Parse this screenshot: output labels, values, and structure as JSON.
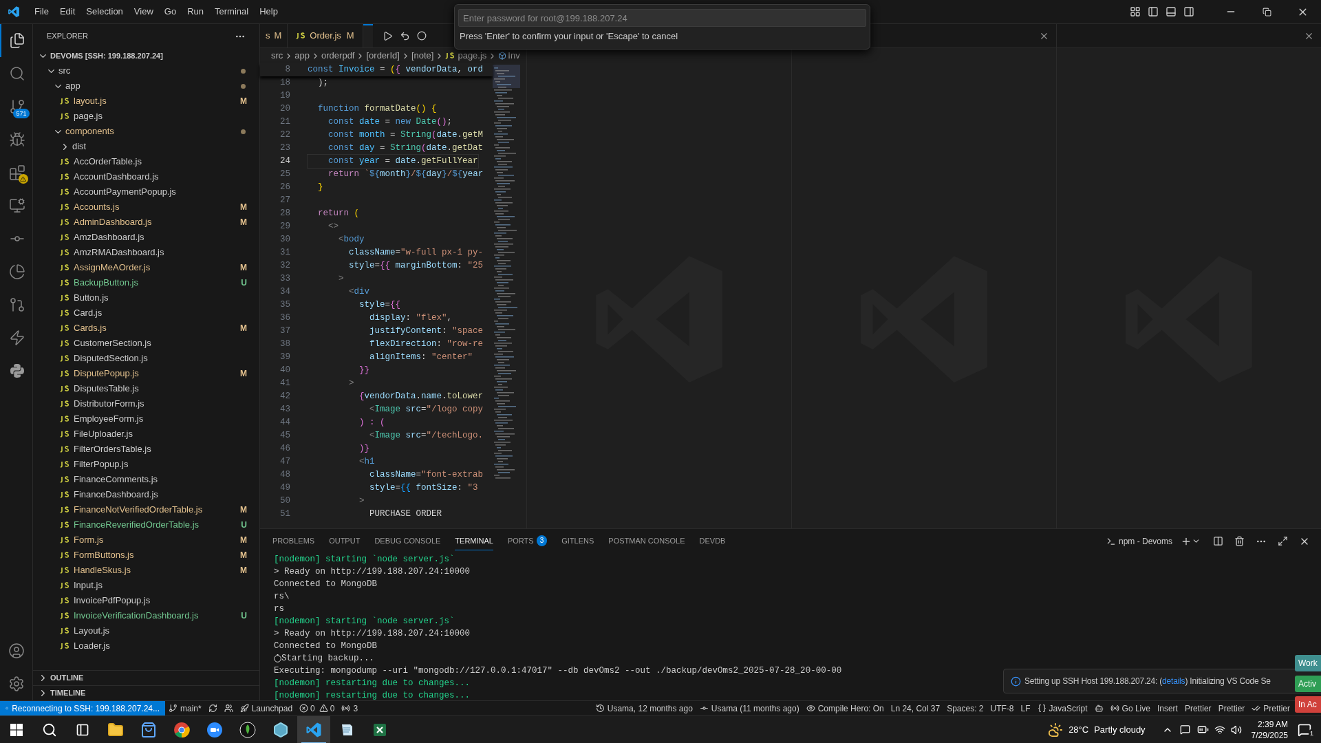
{
  "title_bar": {
    "menus": [
      "File",
      "Edit",
      "Selection",
      "View",
      "Go",
      "Run",
      "Terminal",
      "Help"
    ]
  },
  "command_palette": {
    "placeholder": "Enter password for root@199.188.207.24",
    "hint": "Press 'Enter' to confirm your input or 'Escape' to cancel"
  },
  "activity_bar": {
    "items": [
      {
        "selected": true,
        "alert": false
      },
      {
        "selected": false,
        "alert": false
      },
      {
        "selected": false,
        "alert": false,
        "badge": "571"
      },
      {
        "selected": false,
        "alert": false
      },
      {
        "selected": false,
        "alert": true
      },
      {
        "selected": false,
        "alert": false
      },
      {
        "selected": false,
        "alert": false
      },
      {
        "selected": false,
        "alert": false
      },
      {
        "selected": false,
        "alert": false
      },
      {
        "selected": false,
        "alert": false
      },
      {
        "selected": false,
        "alert": false
      }
    ]
  },
  "explorer": {
    "title": "EXPLORER",
    "root": {
      "label": "DEVOMS [SSH: 199.188.207.24]",
      "expanded": true,
      "children": [
        {
          "kind": "folder",
          "label": "src",
          "expanded": true,
          "modified": true,
          "color": "#cccccc",
          "children": [
            {
              "kind": "folder",
              "label": "app",
              "expanded": true,
              "modified": true,
              "color": "#cccccc",
              "children": [
                {
                  "kind": "file",
                  "label": "layout.js",
                  "color": "#e2c08d",
                  "badge": "M"
                },
                {
                  "kind": "file",
                  "label": "page.js",
                  "color": "#cccccc"
                }
              ]
            },
            {
              "kind": "folder",
              "label": "components",
              "expanded": true,
              "modified": true,
              "color": "#e2c08d",
              "children": [
                {
                  "kind": "folder",
                  "label": "dist",
                  "expanded": false,
                  "modified": false,
                  "color": "#cccccc"
                },
                {
                  "kind": "file",
                  "label": "AccOrderTable.js",
                  "color": "#cccccc"
                },
                {
                  "kind": "file",
                  "label": "AccountDashboard.js",
                  "color": "#cccccc"
                },
                {
                  "kind": "file",
                  "label": "AccountPaymentPopup.js",
                  "color": "#cccccc"
                },
                {
                  "kind": "file",
                  "label": "Accounts.js",
                  "color": "#e2c08d",
                  "badge": "M"
                },
                {
                  "kind": "file",
                  "label": "AdminDashboard.js",
                  "color": "#e2c08d",
                  "badge": "M"
                },
                {
                  "kind": "file",
                  "label": "AmzDashboard.js",
                  "color": "#cccccc"
                },
                {
                  "kind": "file",
                  "label": "AmzRMADashboard.js",
                  "color": "#cccccc"
                },
                {
                  "kind": "file",
                  "label": "AssignMeAOrder.js",
                  "color": "#e2c08d",
                  "badge": "M"
                },
                {
                  "kind": "file",
                  "label": "BackupButton.js",
                  "color": "#73c991",
                  "badge": "U"
                },
                {
                  "kind": "file",
                  "label": "Button.js",
                  "color": "#cccccc"
                },
                {
                  "kind": "file",
                  "label": "Card.js",
                  "color": "#cccccc"
                },
                {
                  "kind": "file",
                  "label": "Cards.js",
                  "color": "#e2c08d",
                  "badge": "M"
                },
                {
                  "kind": "file",
                  "label": "CustomerSection.js",
                  "color": "#cccccc"
                },
                {
                  "kind": "file",
                  "label": "DisputedSection.js",
                  "color": "#cccccc"
                },
                {
                  "kind": "file",
                  "label": "DisputePopup.js",
                  "color": "#e2c08d",
                  "badge": "M"
                },
                {
                  "kind": "file",
                  "label": "DisputesTable.js",
                  "color": "#cccccc"
                },
                {
                  "kind": "file",
                  "label": "DistributorForm.js",
                  "color": "#cccccc"
                },
                {
                  "kind": "file",
                  "label": "EmployeeForm.js",
                  "color": "#cccccc"
                },
                {
                  "kind": "file",
                  "label": "FileUploader.js",
                  "color": "#cccccc"
                },
                {
                  "kind": "file",
                  "label": "FilterOrdersTable.js",
                  "color": "#cccccc"
                },
                {
                  "kind": "file",
                  "label": "FilterPopup.js",
                  "color": "#cccccc"
                },
                {
                  "kind": "file",
                  "label": "FinanceComments.js",
                  "color": "#cccccc"
                },
                {
                  "kind": "file",
                  "label": "FinanceDashboard.js",
                  "color": "#cccccc"
                },
                {
                  "kind": "file",
                  "label": "FinanceNotVerifiedOrderTable.js",
                  "color": "#e2c08d",
                  "badge": "M"
                },
                {
                  "kind": "file",
                  "label": "FinanceReverifiedOrderTable.js",
                  "color": "#73c991",
                  "badge": "U"
                },
                {
                  "kind": "file",
                  "label": "Form.js",
                  "color": "#e2c08d",
                  "badge": "M"
                },
                {
                  "kind": "file",
                  "label": "FormButtons.js",
                  "color": "#e2c08d",
                  "badge": "M"
                },
                {
                  "kind": "file",
                  "label": "HandleSkus.js",
                  "color": "#e2c08d",
                  "badge": "M"
                },
                {
                  "kind": "file",
                  "label": "Input.js",
                  "color": "#cccccc"
                },
                {
                  "kind": "file",
                  "label": "InvoicePdfPopup.js",
                  "color": "#cccccc"
                },
                {
                  "kind": "file",
                  "label": "InvoiceVerificationDashboard.js",
                  "color": "#73c991",
                  "badge": "U"
                },
                {
                  "kind": "file",
                  "label": "Layout.js",
                  "color": "#cccccc"
                },
                {
                  "kind": "file",
                  "label": "Loader.js",
                  "color": "#cccccc"
                }
              ]
            }
          ]
        }
      ]
    },
    "sections": [
      {
        "label": "OUTLINE",
        "expanded": false
      },
      {
        "label": "TIMELINE",
        "expanded": false
      }
    ]
  },
  "editor": {
    "tabs": [
      {
        "kind": "cut",
        "label": "s",
        "status": "M",
        "selected": false
      },
      {
        "kind": "file",
        "label": "Order.js",
        "status": "M",
        "selected": false
      },
      {
        "kind": "hidden",
        "selected": true
      }
    ],
    "breadcrumb": [
      {
        "kind": "folder",
        "text": "src"
      },
      {
        "kind": "folder",
        "text": "app"
      },
      {
        "kind": "folder",
        "text": "orderpdf"
      },
      {
        "kind": "folder",
        "text": "[orderId]"
      },
      {
        "kind": "folder",
        "text": "[note]"
      },
      {
        "kind": "file",
        "text": "page.js"
      },
      {
        "kind": "symbol",
        "text": "Inv"
      }
    ],
    "sticky": {
      "n": "8",
      "tokens": [
        {
          "text": "const ",
          "kind": "kw"
        },
        {
          "text": "Invoice",
          "kind": "cst"
        },
        {
          "text": " = ",
          "kind": "p"
        },
        {
          "text": "(",
          "kind": "b1"
        },
        {
          "text": "{",
          "kind": "b2"
        },
        {
          "text": " vendorData",
          "kind": "var"
        },
        {
          "text": ", ",
          "kind": "p"
        },
        {
          "text": "ord",
          "kind": "var"
        }
      ]
    },
    "lines": [
      {
        "n": "18",
        "current": false,
        "tokens": [
          {
            "text": "  );",
            "kind": "p"
          }
        ]
      },
      {
        "n": "19",
        "current": false
      },
      {
        "n": "20",
        "current": false,
        "tokens": [
          {
            "text": "  function ",
            "kind": "kw"
          },
          {
            "text": "formatDate",
            "kind": "fn"
          },
          {
            "text": "() {",
            "kind": "b1"
          }
        ]
      },
      {
        "n": "21",
        "current": false,
        "tokens": [
          {
            "text": "    const ",
            "kind": "kw"
          },
          {
            "text": "date",
            "kind": "cst"
          },
          {
            "text": " = ",
            "kind": "p"
          },
          {
            "text": "new ",
            "kind": "kw"
          },
          {
            "text": "Date",
            "kind": "cls"
          },
          {
            "text": "()",
            "kind": "b2"
          },
          {
            "text": ";",
            "kind": "p"
          }
        ]
      },
      {
        "n": "22",
        "current": false,
        "tokens": [
          {
            "text": "    const ",
            "kind": "kw"
          },
          {
            "text": "month",
            "kind": "cst"
          },
          {
            "text": " = ",
            "kind": "p"
          },
          {
            "text": "String",
            "kind": "cls"
          },
          {
            "text": "(",
            "kind": "b2"
          },
          {
            "text": "date",
            "kind": "var"
          },
          {
            "text": ".",
            "kind": "p"
          },
          {
            "text": "getM",
            "kind": "fn"
          }
        ]
      },
      {
        "n": "23",
        "current": false,
        "tokens": [
          {
            "text": "    const ",
            "kind": "kw"
          },
          {
            "text": "day",
            "kind": "cst"
          },
          {
            "text": " = ",
            "kind": "p"
          },
          {
            "text": "String",
            "kind": "cls"
          },
          {
            "text": "(",
            "kind": "b2"
          },
          {
            "text": "date",
            "kind": "var"
          },
          {
            "text": ".",
            "kind": "p"
          },
          {
            "text": "getDat",
            "kind": "fn"
          }
        ]
      },
      {
        "n": "24",
        "current": true,
        "tokens": [
          {
            "text": "    const ",
            "kind": "kw"
          },
          {
            "text": "year",
            "kind": "cst"
          },
          {
            "text": " = ",
            "kind": "p"
          },
          {
            "text": "date",
            "kind": "var"
          },
          {
            "text": ".",
            "kind": "p"
          },
          {
            "text": "getFullYear",
            "kind": "fn"
          }
        ]
      },
      {
        "n": "25",
        "current": false,
        "tokens": [
          {
            "text": "    return ",
            "kind": "ctl"
          },
          {
            "text": "`",
            "kind": "str"
          },
          {
            "text": "${",
            "kind": "kw"
          },
          {
            "text": "month",
            "kind": "var"
          },
          {
            "text": "}",
            "kind": "kw"
          },
          {
            "text": "/",
            "kind": "str"
          },
          {
            "text": "${",
            "kind": "kw"
          },
          {
            "text": "day",
            "kind": "var"
          },
          {
            "text": "}",
            "kind": "kw"
          },
          {
            "text": "/",
            "kind": "str"
          },
          {
            "text": "${",
            "kind": "kw"
          },
          {
            "text": "year",
            "kind": "var"
          }
        ]
      },
      {
        "n": "26",
        "current": false,
        "tokens": [
          {
            "text": "  }",
            "kind": "b1"
          }
        ]
      },
      {
        "n": "27",
        "current": false
      },
      {
        "n": "28",
        "current": false,
        "tokens": [
          {
            "text": "  return ",
            "kind": "ctl"
          },
          {
            "text": "(",
            "kind": "b1"
          }
        ]
      },
      {
        "n": "29",
        "current": false,
        "tokens": [
          {
            "text": "    <>",
            "kind": "tag"
          }
        ]
      },
      {
        "n": "30",
        "current": false,
        "tokens": [
          {
            "text": "      <",
            "kind": "tag"
          },
          {
            "text": "body",
            "kind": "tn"
          }
        ]
      },
      {
        "n": "31",
        "current": false,
        "tokens": [
          {
            "text": "        className",
            "kind": "attr"
          },
          {
            "text": "=",
            "kind": "p"
          },
          {
            "text": "\"w-full px-1 py-",
            "kind": "str"
          }
        ]
      },
      {
        "n": "32",
        "current": false,
        "tokens": [
          {
            "text": "        style",
            "kind": "attr"
          },
          {
            "text": "=",
            "kind": "p"
          },
          {
            "text": "{{",
            "kind": "b2"
          },
          {
            "text": " marginBottom",
            "kind": "var"
          },
          {
            "text": ": ",
            "kind": "p"
          },
          {
            "text": "\"25",
            "kind": "str"
          }
        ]
      },
      {
        "n": "33",
        "current": false,
        "tokens": [
          {
            "text": "      >",
            "kind": "tag"
          }
        ]
      },
      {
        "n": "34",
        "current": false,
        "tokens": [
          {
            "text": "        <",
            "kind": "tag"
          },
          {
            "text": "div",
            "kind": "tn"
          }
        ]
      },
      {
        "n": "35",
        "current": false,
        "tokens": [
          {
            "text": "          style",
            "kind": "attr"
          },
          {
            "text": "=",
            "kind": "p"
          },
          {
            "text": "{{",
            "kind": "b2"
          }
        ]
      },
      {
        "n": "36",
        "current": false,
        "tokens": [
          {
            "text": "            display",
            "kind": "var"
          },
          {
            "text": ": ",
            "kind": "p"
          },
          {
            "text": "\"flex\"",
            "kind": "str"
          },
          {
            "text": ",",
            "kind": "p"
          }
        ]
      },
      {
        "n": "37",
        "current": false,
        "tokens": [
          {
            "text": "            justifyContent",
            "kind": "var"
          },
          {
            "text": ": ",
            "kind": "p"
          },
          {
            "text": "\"space",
            "kind": "str"
          }
        ]
      },
      {
        "n": "38",
        "current": false,
        "tokens": [
          {
            "text": "            flexDirection",
            "kind": "var"
          },
          {
            "text": ": ",
            "kind": "p"
          },
          {
            "text": "\"row-re",
            "kind": "str"
          }
        ]
      },
      {
        "n": "39",
        "current": false,
        "tokens": [
          {
            "text": "            alignItems",
            "kind": "var"
          },
          {
            "text": ": ",
            "kind": "p"
          },
          {
            "text": "\"center\"",
            "kind": "str"
          }
        ]
      },
      {
        "n": "40",
        "current": false,
        "tokens": [
          {
            "text": "          }}",
            "kind": "b2"
          }
        ]
      },
      {
        "n": "41",
        "current": false,
        "tokens": [
          {
            "text": "        >",
            "kind": "tag"
          }
        ]
      },
      {
        "n": "42",
        "current": false,
        "tokens": [
          {
            "text": "          {",
            "kind": "b2"
          },
          {
            "text": "vendorData",
            "kind": "var"
          },
          {
            "text": ".",
            "kind": "p"
          },
          {
            "text": "name",
            "kind": "var"
          },
          {
            "text": ".",
            "kind": "p"
          },
          {
            "text": "toLower",
            "kind": "fn"
          }
        ]
      },
      {
        "n": "43",
        "current": false,
        "tokens": [
          {
            "text": "            <",
            "kind": "tag"
          },
          {
            "text": "Image",
            "kind": "cls"
          },
          {
            "text": " src",
            "kind": "attr"
          },
          {
            "text": "=",
            "kind": "p"
          },
          {
            "text": "\"/logo copy",
            "kind": "str"
          }
        ]
      },
      {
        "n": "44",
        "current": false,
        "tokens": [
          {
            "text": "          ) : (",
            "kind": "b2"
          }
        ]
      },
      {
        "n": "45",
        "current": false,
        "tokens": [
          {
            "text": "            <",
            "kind": "tag"
          },
          {
            "text": "Image",
            "kind": "cls"
          },
          {
            "text": " src",
            "kind": "attr"
          },
          {
            "text": "=",
            "kind": "p"
          },
          {
            "text": "\"/techLogo.",
            "kind": "str"
          }
        ]
      },
      {
        "n": "46",
        "current": false,
        "tokens": [
          {
            "text": "          )}",
            "kind": "b2"
          }
        ]
      },
      {
        "n": "47",
        "current": false,
        "tokens": [
          {
            "text": "          <",
            "kind": "tag"
          },
          {
            "text": "h1",
            "kind": "tn"
          }
        ]
      },
      {
        "n": "48",
        "current": false,
        "tokens": [
          {
            "text": "            className",
            "kind": "attr"
          },
          {
            "text": "=",
            "kind": "p"
          },
          {
            "text": "\"font-extrab",
            "kind": "str"
          }
        ]
      },
      {
        "n": "49",
        "current": false,
        "tokens": [
          {
            "text": "            style",
            "kind": "attr"
          },
          {
            "text": "=",
            "kind": "p"
          },
          {
            "text": "{{",
            "kind": "b3"
          },
          {
            "text": " fontSize",
            "kind": "var"
          },
          {
            "text": ": ",
            "kind": "p"
          },
          {
            "text": "\"3",
            "kind": "str"
          }
        ]
      },
      {
        "n": "50",
        "current": false,
        "tokens": [
          {
            "text": "          >",
            "kind": "tag"
          }
        ]
      },
      {
        "n": "51",
        "current": false,
        "tokens": [
          {
            "text": "            PURCHASE ORDER",
            "kind": "p"
          }
        ]
      }
    ]
  },
  "panel": {
    "tabs": [
      {
        "label": "PROBLEMS",
        "selected": false
      },
      {
        "label": "OUTPUT",
        "selected": false
      },
      {
        "label": "DEBUG CONSOLE",
        "selected": false
      },
      {
        "label": "TERMINAL",
        "selected": true
      },
      {
        "label": "PORTS",
        "selected": false,
        "badge": "3"
      },
      {
        "label": "GITLENS",
        "selected": false
      },
      {
        "label": "POSTMAN CONSOLE",
        "selected": false
      },
      {
        "label": "DEVDB",
        "selected": false
      }
    ],
    "terminal_name": "npm - Devoms",
    "lines": [
      {
        "kind": "text",
        "text": "[nodemon] starting `node server.js`",
        "color": "#23d18b"
      },
      {
        "kind": "text",
        "text": "> Ready on http://199.188.207.24:10000",
        "color": "#cccccc"
      },
      {
        "kind": "text",
        "text": "Connected to MongoDB",
        "color": "#cccccc"
      },
      {
        "kind": "text",
        "text": "rs\\",
        "color": "#cccccc"
      },
      {
        "kind": "text",
        "text": "rs",
        "color": "#cccccc"
      },
      {
        "kind": "text",
        "text": "[nodemon] starting `node server.js`",
        "color": "#23d18b"
      },
      {
        "kind": "text",
        "text": "> Ready on http://199.188.207.24:10000",
        "color": "#cccccc"
      },
      {
        "kind": "text",
        "text": "Connected to MongoDB",
        "color": "#cccccc"
      },
      {
        "kind": "icon-text",
        "text": "Starting backup...",
        "color": "#cccccc"
      },
      {
        "kind": "text",
        "text": "Executing: mongodump --uri \"mongodb://127.0.0.1:47017\" --db devOms2 --out ./backup/devOms2_2025-07-28_20-00-00",
        "color": "#cccccc"
      },
      {
        "kind": "text",
        "text": "[nodemon] restarting due to changes...",
        "color": "#23d18b"
      },
      {
        "kind": "text",
        "text": "[nodemon] restarting due to changes...",
        "color": "#23d18b"
      }
    ]
  },
  "notification": {
    "before": "Setting up SSH Host 199.188.207.24: (",
    "link": "details",
    "after": ") Initializing VS Code Se"
  },
  "side_buttons": [
    {
      "label": "Work",
      "color": "#3f8f8f"
    },
    {
      "label": "Activ",
      "color": "#2f9e55"
    },
    {
      "label": "In Ac",
      "color": "#d0413b"
    }
  ],
  "status_bar": {
    "left": [
      {
        "kind": "remote",
        "text": "Reconnecting to SSH: 199.188.207.24..."
      },
      {
        "kind": "branch",
        "text": "main*"
      },
      {
        "kind": "sync"
      },
      {
        "kind": "share"
      },
      {
        "kind": "launchpad",
        "text": "Launchpad"
      },
      {
        "kind": "problems",
        "errors": "0",
        "warnings": "0"
      },
      {
        "kind": "ports",
        "text": "3"
      }
    ],
    "right": [
      {
        "kind": "blame",
        "text": "Usama, 12 months ago"
      },
      {
        "kind": "commit",
        "text": "Usama (11 months ago)"
      },
      {
        "kind": "eye",
        "text": "Compile Hero: On"
      },
      {
        "kind": "plain",
        "text": "Ln 24, Col 37"
      },
      {
        "kind": "plain",
        "text": "Spaces: 2"
      },
      {
        "kind": "plain",
        "text": "UTF-8"
      },
      {
        "kind": "plain",
        "text": "LF"
      },
      {
        "kind": "braces",
        "text": "JavaScript"
      },
      {
        "kind": "copilot"
      },
      {
        "kind": "live",
        "text": "Go Live"
      },
      {
        "kind": "plain",
        "text": "Insert"
      },
      {
        "kind": "plain",
        "text": "Prettier"
      },
      {
        "kind": "plain",
        "text": "Prettier"
      },
      {
        "kind": "check",
        "text": "Prettier"
      }
    ]
  },
  "taskbar": {
    "apps": [
      {
        "kind": "explorer",
        "active": false
      },
      {
        "kind": "store",
        "active": false
      },
      {
        "kind": "chrome",
        "active": false
      },
      {
        "kind": "zoom",
        "active": false
      },
      {
        "kind": "leaf",
        "active": false
      },
      {
        "kind": "hex",
        "active": false
      },
      {
        "kind": "vscode",
        "active": true
      },
      {
        "kind": "notes",
        "active": false
      },
      {
        "kind": "sheet",
        "active": false
      }
    ],
    "temperature": "28°C",
    "weather": "Partly cloudy",
    "time": "2:39 AM",
    "date": "7/29/2025",
    "notifications": "1"
  }
}
